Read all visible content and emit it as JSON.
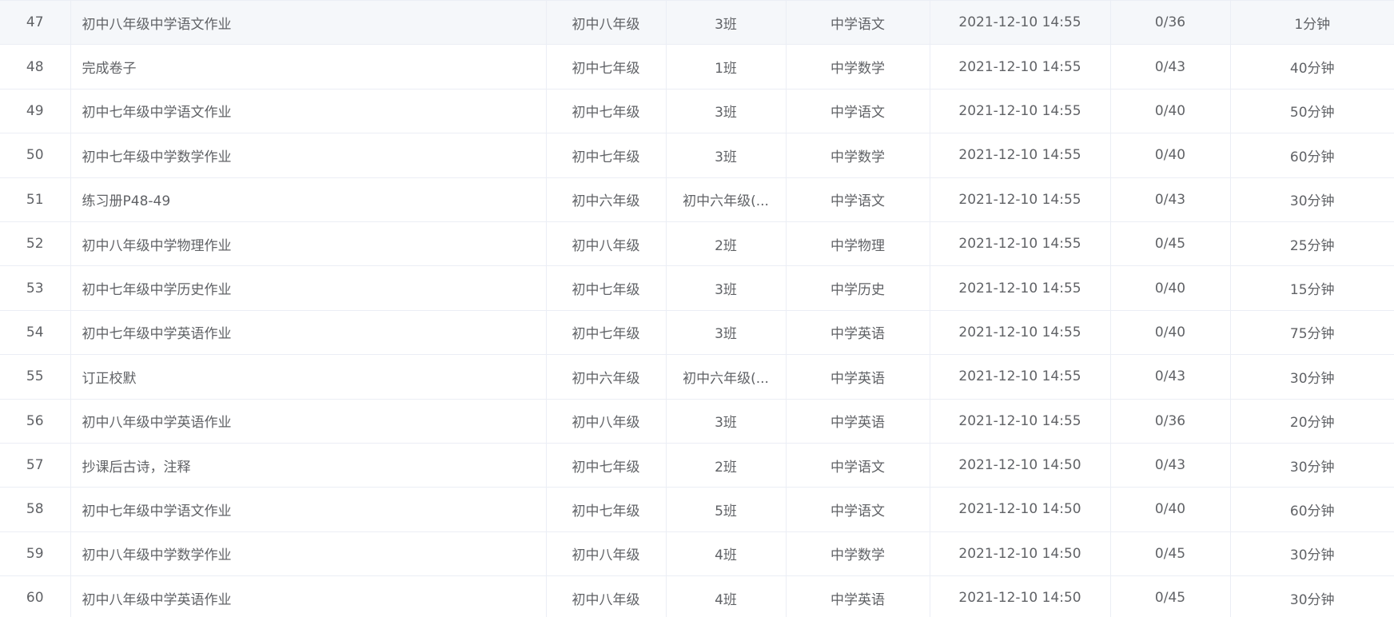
{
  "table": {
    "rows": [
      {
        "num": "47",
        "title": "初中八年级中学语文作业",
        "grade": "初中八年级",
        "class": "3班",
        "subject": "中学语文",
        "time": "2021-12-10 14:55",
        "submit": "0/36",
        "duration": "1分钟"
      },
      {
        "num": "48",
        "title": "完成卷子",
        "grade": "初中七年级",
        "class": "1班",
        "subject": "中学数学",
        "time": "2021-12-10 14:55",
        "submit": "0/43",
        "duration": "40分钟"
      },
      {
        "num": "49",
        "title": "初中七年级中学语文作业",
        "grade": "初中七年级",
        "class": "3班",
        "subject": "中学语文",
        "time": "2021-12-10 14:55",
        "submit": "0/40",
        "duration": "50分钟"
      },
      {
        "num": "50",
        "title": "初中七年级中学数学作业",
        "grade": "初中七年级",
        "class": "3班",
        "subject": "中学数学",
        "time": "2021-12-10 14:55",
        "submit": "0/40",
        "duration": "60分钟"
      },
      {
        "num": "51",
        "title": "练习册P48-49",
        "grade": "初中六年级",
        "class": "初中六年级(...",
        "subject": "中学语文",
        "time": "2021-12-10 14:55",
        "submit": "0/43",
        "duration": "30分钟"
      },
      {
        "num": "52",
        "title": "初中八年级中学物理作业",
        "grade": "初中八年级",
        "class": "2班",
        "subject": "中学物理",
        "time": "2021-12-10 14:55",
        "submit": "0/45",
        "duration": "25分钟"
      },
      {
        "num": "53",
        "title": "初中七年级中学历史作业",
        "grade": "初中七年级",
        "class": "3班",
        "subject": "中学历史",
        "time": "2021-12-10 14:55",
        "submit": "0/40",
        "duration": "15分钟"
      },
      {
        "num": "54",
        "title": "初中七年级中学英语作业",
        "grade": "初中七年级",
        "class": "3班",
        "subject": "中学英语",
        "time": "2021-12-10 14:55",
        "submit": "0/40",
        "duration": "75分钟"
      },
      {
        "num": "55",
        "title": "订正校默",
        "grade": "初中六年级",
        "class": "初中六年级(...",
        "subject": "中学英语",
        "time": "2021-12-10 14:55",
        "submit": "0/43",
        "duration": "30分钟"
      },
      {
        "num": "56",
        "title": "初中八年级中学英语作业",
        "grade": "初中八年级",
        "class": "3班",
        "subject": "中学英语",
        "time": "2021-12-10 14:55",
        "submit": "0/36",
        "duration": "20分钟"
      },
      {
        "num": "57",
        "title": "抄课后古诗，注释",
        "grade": "初中七年级",
        "class": "2班",
        "subject": "中学语文",
        "time": "2021-12-10 14:50",
        "submit": "0/43",
        "duration": "30分钟"
      },
      {
        "num": "58",
        "title": "初中七年级中学语文作业",
        "grade": "初中七年级",
        "class": "5班",
        "subject": "中学语文",
        "time": "2021-12-10 14:50",
        "submit": "0/40",
        "duration": "60分钟"
      },
      {
        "num": "59",
        "title": "初中八年级中学数学作业",
        "grade": "初中八年级",
        "class": "4班",
        "subject": "中学数学",
        "time": "2021-12-10 14:50",
        "submit": "0/45",
        "duration": "30分钟"
      },
      {
        "num": "60",
        "title": "初中八年级中学英语作业",
        "grade": "初中八年级",
        "class": "4班",
        "subject": "中学英语",
        "time": "2021-12-10 14:50",
        "submit": "0/45",
        "duration": "30分钟"
      }
    ]
  },
  "colors": {
    "text": "#606266",
    "border": "#ebeef5",
    "hover_row": "#f5f7fa"
  }
}
